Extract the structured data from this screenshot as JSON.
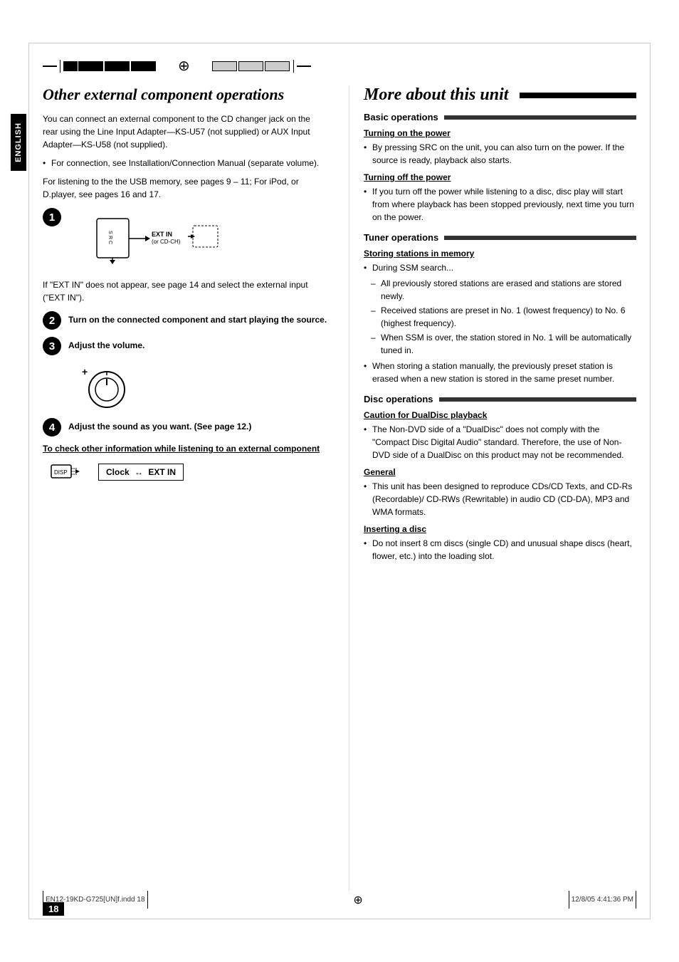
{
  "page": {
    "number": "18",
    "footer_left": "EN12-19KD-G725[UN]f.indd  18",
    "footer_right": "12/8/05  4:41:36 PM"
  },
  "left_section": {
    "title": "Other external component operations",
    "english_label": "ENGLISH",
    "body1": "You can connect an external component to the CD changer jack on the rear using the Line Input Adapter—KS-U57 (not supplied) or AUX Input Adapter—KS-U58 (not supplied).",
    "bullet1": "For connection, see Installation/Connection Manual (separate volume).",
    "body2": "For listening to the the USB memory, see pages 9 – 11; For iPod, or D.player, see pages 16 and 17.",
    "step1_note": "If \"EXT IN\" does not appear, see page 14 and select the external input (\"EXT IN\").",
    "step2_text": "Turn on the connected component and start playing the source.",
    "step3_text": "Adjust the volume.",
    "step4_text": "Adjust the sound as you want. (See page 12.)",
    "ext_in_label": "EXT IN (or CD-CH)",
    "check_heading": "To check other information while listening to an external component",
    "clock_label": "Clock",
    "ext_in_arrow_label": "EXT IN",
    "disp_label": "DISP"
  },
  "right_section": {
    "title": "More about this unit",
    "basic_ops_header": "Basic operations",
    "turning_on_heading": "Turning on the power",
    "turning_on_bullet": "By pressing SRC on the unit, you can also turn on the power. If the source is ready, playback also starts.",
    "turning_off_heading": "Turning off the power",
    "turning_off_bullet": "If you turn off the power while listening to a disc, disc play will start from where playback has been stopped previously, next time you turn on the power.",
    "tuner_ops_header": "Tuner operations",
    "storing_heading": "Storing stations in memory",
    "storing_bullet1": "During SSM search...",
    "storing_dash1": "All previously stored stations are erased and stations are stored newly.",
    "storing_dash2": "Received stations are preset in No. 1 (lowest frequency) to No. 6 (highest frequency).",
    "storing_dash3": "When SSM is over, the station stored in No. 1 will be automatically tuned in.",
    "storing_bullet2": "When storing a station manually, the previously preset station is erased when a new station is stored in the same preset number.",
    "disc_ops_header": "Disc operations",
    "caution_heading": "Caution for DualDisc playback",
    "caution_bullet": "The Non-DVD side of a \"DualDisc\" does not comply with the \"Compact Disc Digital Audio\" standard. Therefore, the use of Non-DVD side of a DualDisc on this product may not be recommended.",
    "general_heading": "General",
    "general_bullet": "This unit has been designed to reproduce CDs/CD Texts, and CD-Rs (Recordable)/ CD-RWs (Rewritable) in audio CD (CD-DA), MP3 and WMA formats.",
    "inserting_heading": "Inserting a disc",
    "inserting_bullet": "Do not insert 8 cm discs (single CD) and unusual shape discs (heart, flower, etc.) into the loading slot."
  }
}
